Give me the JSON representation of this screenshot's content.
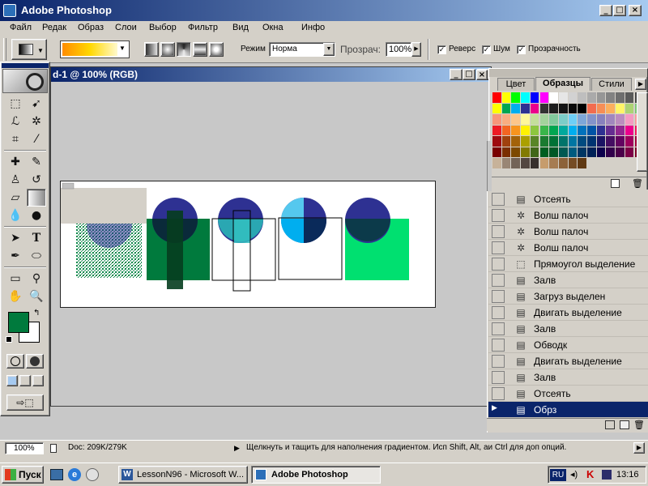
{
  "app": {
    "title": "Adobe Photoshop"
  },
  "menu": [
    "Файл",
    "Редак",
    "Образ",
    "Слои",
    "Выбор",
    "Фильтр",
    "Вид",
    "Окна",
    "Инфо"
  ],
  "options": {
    "mode_label": "Режим",
    "mode_value": "Норма",
    "opacity_label": "Прозрач:",
    "opacity_value": "100%",
    "reverse": "Реверс",
    "dither": "Шум",
    "transparency": "Прозрачность"
  },
  "document": {
    "title": "d-1 @ 100% (RGB)"
  },
  "swatches_panel": {
    "tabs": [
      "Цвет",
      "Образцы",
      "Стили"
    ],
    "active_tab": "Образцы",
    "colors": [
      "#ff0000",
      "#ffff00",
      "#00ff00",
      "#00ffff",
      "#0000ff",
      "#ff00ff",
      "#ffffff",
      "#e6e6e6",
      "#d2d2d2",
      "#bebebe",
      "#aaaaaa",
      "#969696",
      "#828282",
      "#6e6e6e",
      "#5a5a5a",
      "#464646",
      "#ffff00",
      "#00a651",
      "#00aeef",
      "#2e3192",
      "#ec008c",
      "#323232",
      "#1e1e1e",
      "#141414",
      "#0a0a0a",
      "#000000",
      "#f26c4f",
      "#f68e56",
      "#fbaf5d",
      "#fff568",
      "#acd373",
      "#7cc576",
      "#f7977a",
      "#f9ad81",
      "#fdc68a",
      "#fff79a",
      "#c4df9b",
      "#a3d39c",
      "#82ca9d",
      "#7bcdc8",
      "#6ecff6",
      "#7ea7d8",
      "#8493ca",
      "#8882be",
      "#a187be",
      "#bc8dbf",
      "#f49ac2",
      "#f6989d",
      "#ed1c24",
      "#f26522",
      "#f7941d",
      "#fff200",
      "#8dc63f",
      "#39b54a",
      "#00a651",
      "#00a99d",
      "#00aeef",
      "#0072bc",
      "#0054a6",
      "#2e3192",
      "#662d91",
      "#92278f",
      "#ec008c",
      "#ed145b",
      "#9e0b0f",
      "#a0410d",
      "#a36209",
      "#aba000",
      "#598527",
      "#1a7b30",
      "#007236",
      "#00746b",
      "#0076a3",
      "#004b80",
      "#003471",
      "#1b1464",
      "#440e62",
      "#630460",
      "#9e005d",
      "#9e0039",
      "#790000",
      "#7b2e00",
      "#7d4900",
      "#827b00",
      "#406618",
      "#005e20",
      "#005826",
      "#005952",
      "#005b7f",
      "#003663",
      "#002157",
      "#0d004c",
      "#32004b",
      "#4b0049",
      "#7b0046",
      "#7a0026",
      "#c7b299",
      "#998675",
      "#736357",
      "#534741",
      "#37302d",
      "#c69c6d",
      "#a67c52",
      "#8c6239",
      "#754c24",
      "#603913"
    ]
  },
  "history": [
    {
      "icon": "snapshot-icon",
      "glyph": "▤",
      "label": "Отсеять"
    },
    {
      "icon": "magic-wand-icon",
      "glyph": "✲",
      "label": "Волш палоч"
    },
    {
      "icon": "magic-wand-icon",
      "glyph": "✲",
      "label": "Волш палоч"
    },
    {
      "icon": "magic-wand-icon",
      "glyph": "✲",
      "label": "Волш палоч"
    },
    {
      "icon": "marquee-icon",
      "glyph": "⬚",
      "label": "Прямоугол выделение"
    },
    {
      "icon": "snapshot-icon",
      "glyph": "▤",
      "label": "Залв"
    },
    {
      "icon": "snapshot-icon",
      "glyph": "▤",
      "label": "Загруз выделен"
    },
    {
      "icon": "snapshot-icon",
      "glyph": "▤",
      "label": "Двигать выделение"
    },
    {
      "icon": "snapshot-icon",
      "glyph": "▤",
      "label": "Залв"
    },
    {
      "icon": "snapshot-icon",
      "glyph": "▤",
      "label": "Обводк"
    },
    {
      "icon": "snapshot-icon",
      "glyph": "▤",
      "label": "Двигать выделение"
    },
    {
      "icon": "snapshot-icon",
      "glyph": "▤",
      "label": "Залв"
    },
    {
      "icon": "snapshot-icon",
      "glyph": "▤",
      "label": "Отсеять"
    },
    {
      "icon": "snapshot-icon",
      "glyph": "▤",
      "label": "Обрз"
    }
  ],
  "history_selected": 13,
  "status": {
    "zoom": "100%",
    "doc": "Doc: 209K/279K",
    "hint": "Щелкнуть и тащить для наполнения градиентом.  Исп Shift, Alt, аи Ctrl для доп опций."
  },
  "taskbar": {
    "start": "Пуск",
    "tasks": [
      "LessonN96 - Microsoft W...",
      "Adobe Photoshop"
    ],
    "lang": "RU",
    "time": "13:16"
  },
  "colors": {
    "foreground": "#007a3d",
    "background": "#ffffff",
    "title_active": "#0a246a"
  }
}
